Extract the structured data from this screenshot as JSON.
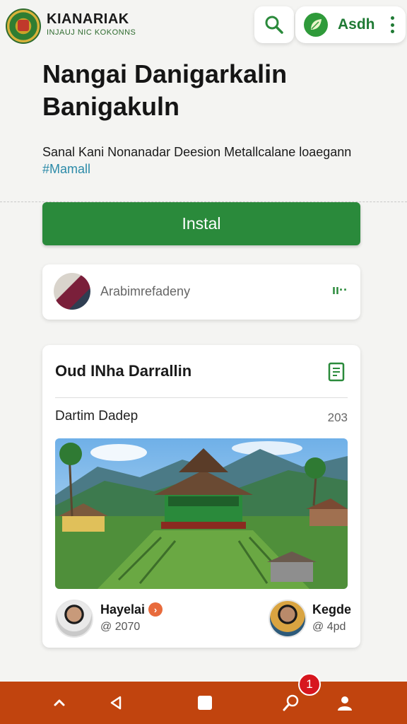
{
  "header": {
    "brand_name": "KIANARIAK",
    "brand_subtitle": "INJAUJ NIC KOKONNS",
    "user_name": "Asdh"
  },
  "hero": {
    "title": "Nangai Danigarkalin Banigakuln",
    "description": "Sanal Kani Nonanadar Deesion Metallcalane loaegann",
    "tag": "#Mamall"
  },
  "install_button": {
    "label": "Instal"
  },
  "comment_card": {
    "text": "Arabimrefadeny",
    "action_label": "ıı··"
  },
  "post": {
    "title": "Oud INha Darrallin",
    "subtitle": "Dartim Dadep",
    "count": "203",
    "authors": [
      {
        "name": "Hayelai",
        "meta": "@ 2070"
      },
      {
        "name": "Kegde",
        "meta": "@ 4pd"
      }
    ]
  },
  "bottom_nav": {
    "items": [
      "chevron-up-icon",
      "back-icon",
      "home-square-icon",
      "search-icon",
      "profile-icon"
    ],
    "badge": "1"
  },
  "colors": {
    "primary_green": "#2a8a3b",
    "nav_orange": "#c1440e",
    "badge_red": "#d7161e",
    "tag_blue": "#2b8aa8"
  }
}
